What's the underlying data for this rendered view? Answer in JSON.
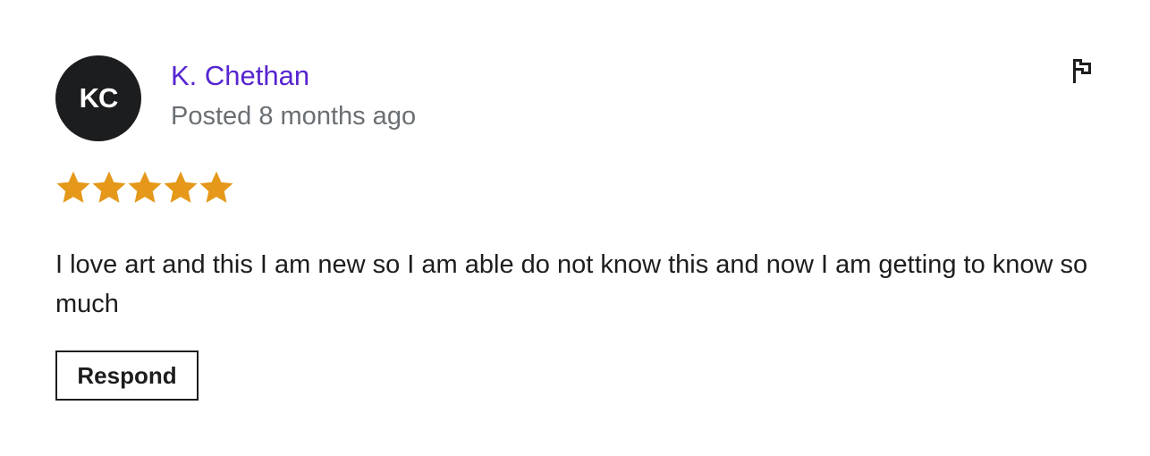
{
  "review": {
    "avatar_initials": "KC",
    "reviewer_name": "K. Chethan",
    "posted_time": "Posted 8 months ago",
    "rating": 5,
    "rating_max": 5,
    "text": "I love art and this I am new so I am able do not know this and now I am getting to know so much",
    "respond_label": "Respond",
    "flag_icon": "flag-icon"
  },
  "colors": {
    "avatar_bg": "#1c1d1f",
    "name_link": "#5624d0",
    "secondary_text": "#6a6f73",
    "star": "#e59819",
    "body_text": "#1c1d1f"
  }
}
